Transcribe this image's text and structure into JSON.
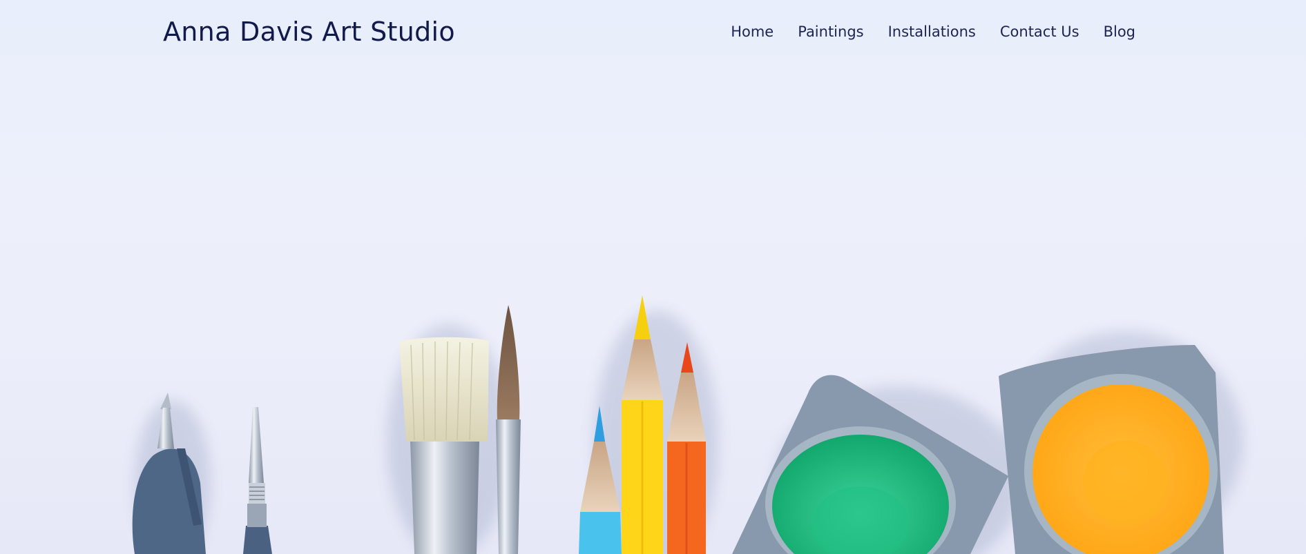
{
  "site": {
    "title": "Anna Davis Art Studio"
  },
  "nav": {
    "items": [
      {
        "label": "Home"
      },
      {
        "label": "Paintings"
      },
      {
        "label": "Installations"
      },
      {
        "label": "Contact Us"
      },
      {
        "label": "Blog"
      }
    ]
  },
  "hero": {
    "image": "art-supplies-photo",
    "colors": {
      "background": "#eceefa",
      "title": "#111a4a",
      "nav_text": "#1b2454",
      "green_paint": "#1fbf83",
      "orange_paint": "#ffb21f",
      "yellow_pencil": "#ffd51a",
      "orange_pencil": "#f5661f",
      "blue_pencil": "#49c2ee",
      "palette_gray": "#8898ad"
    }
  }
}
